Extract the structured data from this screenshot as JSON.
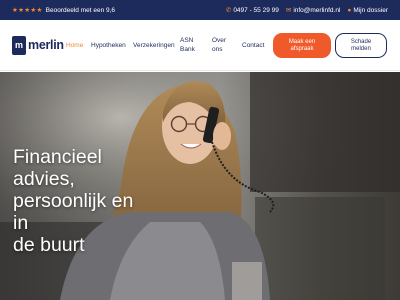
{
  "topbar": {
    "stars": "★★★★★",
    "rating_text": "Beoordeeld met een 9,6",
    "phone_icon": "phone-icon",
    "phone": "0497 - 55 29 99",
    "email_icon": "envelope-icon",
    "email": "info@merlinfd.nl",
    "dossier_icon": "user-icon",
    "dossier": "Mijn dossier"
  },
  "brand": {
    "name": "merlin",
    "mark": "m"
  },
  "nav": {
    "home": "Home",
    "hypotheken": "Hypotheken",
    "verzekeringen": "Verzekeringen",
    "asn_line1": "ASN",
    "asn_line2": "Bank",
    "over_line1": "Over",
    "over_line2": "ons",
    "contact": "Contact"
  },
  "buttons": {
    "appointment_line1": "Maak een",
    "appointment_line2": "afspraak",
    "claim_line1": "Schade",
    "claim_line2": "melden"
  },
  "hero": {
    "title_lines": [
      "Financieel",
      "advies,",
      "persoonlijk en",
      "in",
      "de buurt"
    ]
  },
  "colors": {
    "navy": "#1d2a5c",
    "orange": "#f05a2a",
    "accent": "#f08a34"
  }
}
